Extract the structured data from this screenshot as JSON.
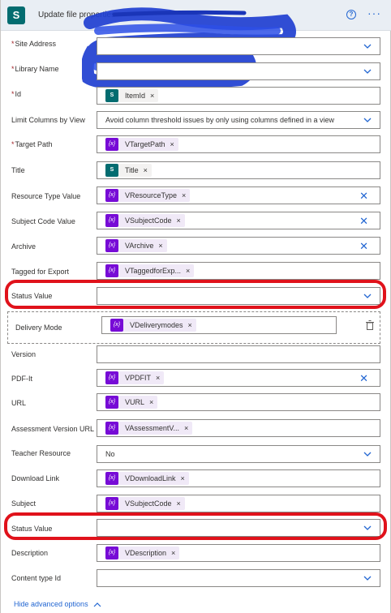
{
  "header": {
    "title": "Update file properties-",
    "help_icon": "question-circle-icon",
    "more_icon": "ellipsis-icon",
    "brand_color": "#036c70",
    "accent_color": "#2266d2"
  },
  "fields": {
    "site_address": {
      "label": "Site Address",
      "required": "*"
    },
    "library_name": {
      "label": "Library Name",
      "required": "*"
    },
    "id": {
      "label": "Id",
      "required": "*",
      "token": "ItemId"
    },
    "limit_columns": {
      "label": "Limit Columns by View",
      "value": "Avoid column threshold issues by only using columns defined in a view"
    },
    "target_path": {
      "label": "Target Path",
      "required": "*",
      "token": "VTargetPath"
    },
    "title": {
      "label": "Title",
      "token": "Title"
    },
    "resource_type": {
      "label": "Resource Type Value",
      "token": "VResourceType"
    },
    "subject_code": {
      "label": "Subject Code Value",
      "token": "VSubjectCode"
    },
    "archive": {
      "label": "Archive",
      "token": "VArchive"
    },
    "tagged_for_export": {
      "label": "Tagged for Export",
      "token": "VTaggedforExp..."
    },
    "status_value_1": {
      "label": "Status Value"
    },
    "delivery_mode": {
      "label": "Delivery Mode",
      "token": "VDeliverymodes"
    },
    "version": {
      "label": "Version"
    },
    "pdf_it": {
      "label": "PDF-It",
      "token": "VPDFIT"
    },
    "url": {
      "label": "URL",
      "token": "VURL"
    },
    "assessment_version_url": {
      "label": "Assessment Version URL",
      "token": "VAssessmentV..."
    },
    "teacher_resource": {
      "label": "Teacher Resource",
      "value": "No"
    },
    "download_link": {
      "label": "Download Link",
      "token": "VDownloadLink"
    },
    "subject": {
      "label": "Subject",
      "token": "VSubjectCode"
    },
    "status_value_2": {
      "label": "Status Value"
    },
    "description": {
      "label": "Description",
      "token": "VDescription"
    },
    "content_type_id": {
      "label": "Content type Id"
    }
  },
  "token_icon": "{x}",
  "sp_token_icon": "S",
  "remove_glyph": "×",
  "clear_glyph": "✕",
  "footer": {
    "label": "Hide advanced options"
  },
  "highlight_color": "#e0121b",
  "variable_color": "#770bd6"
}
